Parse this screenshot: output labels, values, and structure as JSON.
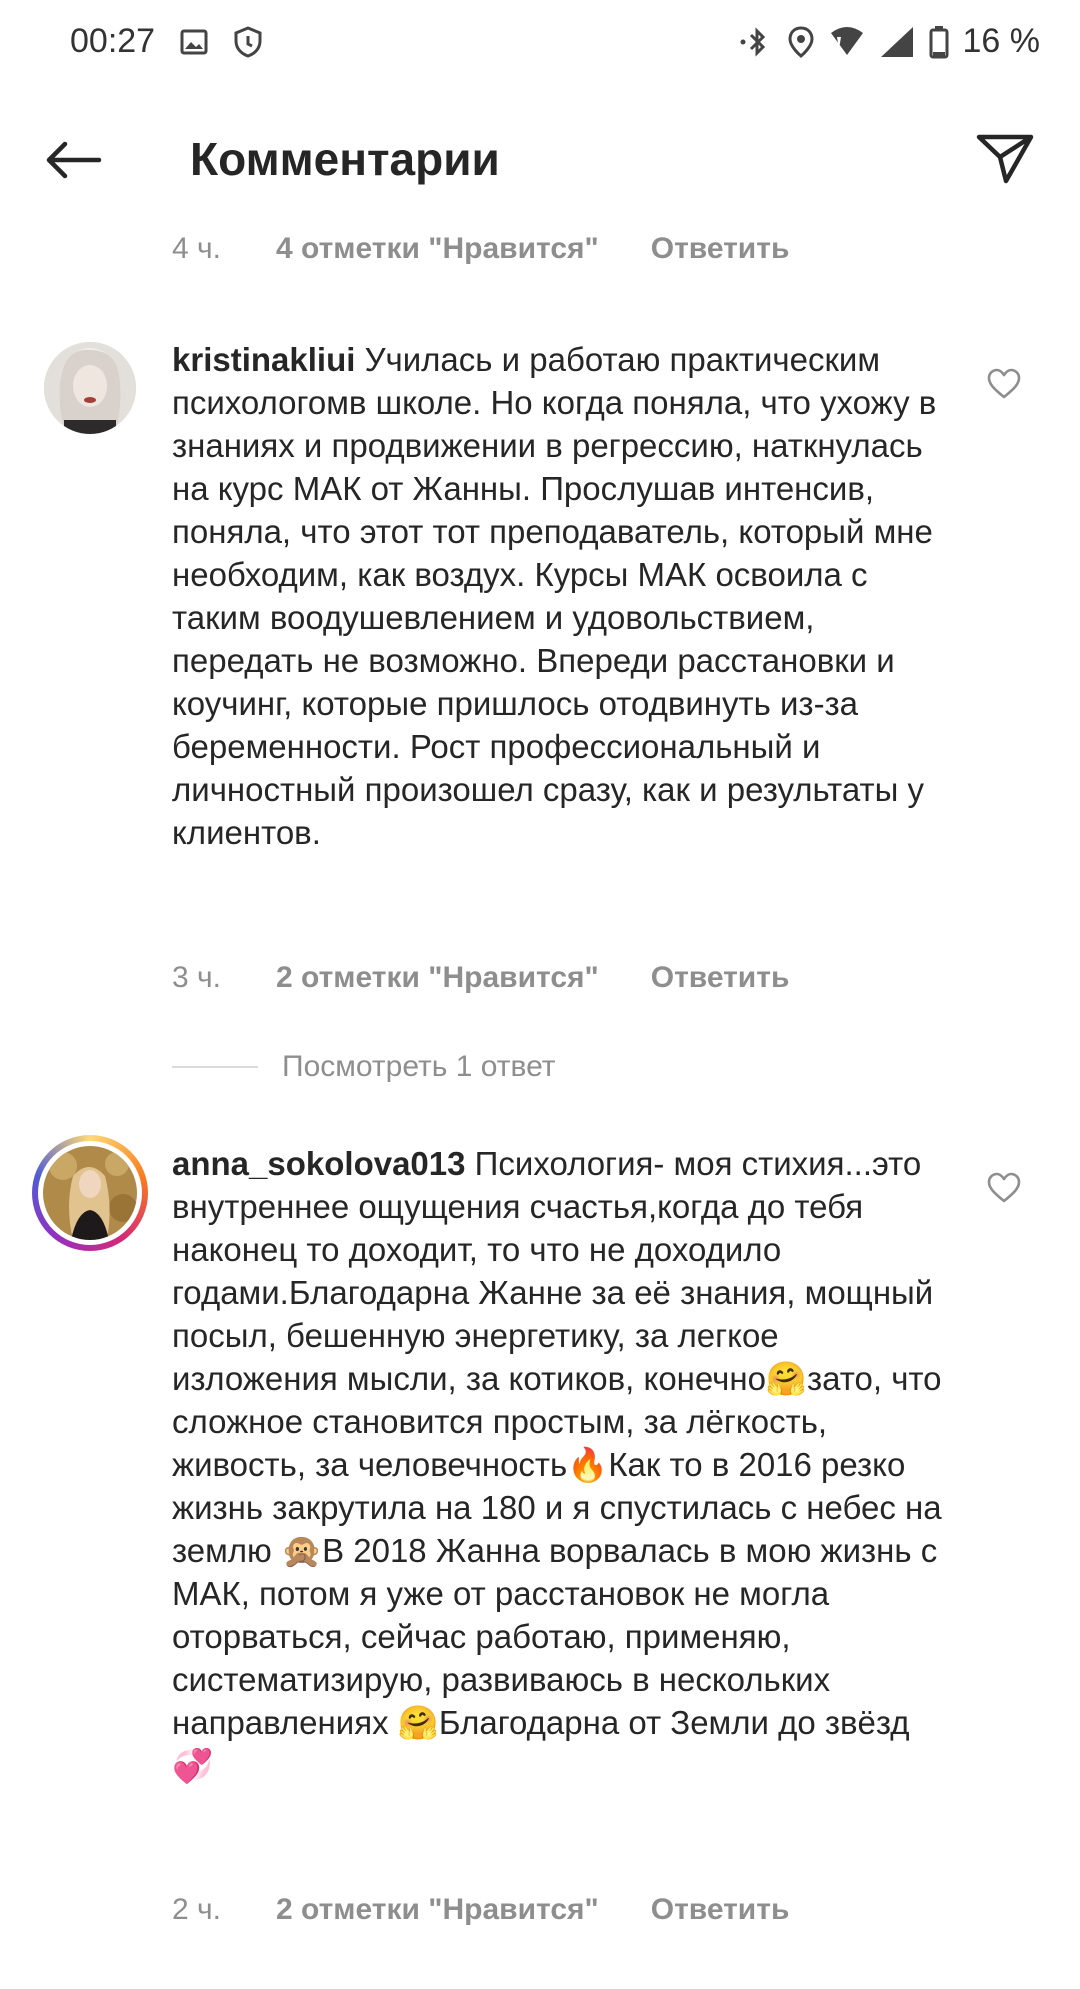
{
  "status_bar": {
    "time": "00:27",
    "battery": "16 %",
    "icons": [
      "image-icon",
      "shield-icon",
      "bluetooth-icon",
      "location-icon",
      "wifi-icon",
      "signal-icon",
      "battery-icon"
    ]
  },
  "header": {
    "title": "Комментарии",
    "back_icon": "back-arrow-icon",
    "send_icon": "paper-plane-icon"
  },
  "previous_comment_meta": {
    "time": "4 ч.",
    "likes": "4 отметки \"Нравится\"",
    "reply": "Ответить"
  },
  "comments": [
    {
      "username": "kristinakliui",
      "text": "Училась и работаю практическим психологомв школе. Но когда поняла, что ухожу в знаниях и продвижении в регрессию, наткнулась на курс МАК от Жанны. Прослушав интенсив, поняла, что этот тот преподаватель, который мне необходим, как воздух. Курсы МАК освоила с таким воодушевлением и удовольствием, передать не возможно. Впереди расстановки и коучинг, которые пришлось отодвинуть из-за беременности. Рост профессиональный и личностный произошел сразу, как и результаты у клиентов.",
      "time": "3 ч.",
      "likes": "2 отметки \"Нравится\"",
      "reply": "Ответить",
      "view_replies": "Посмотреть 1 ответ"
    },
    {
      "username": "anna_sokolova013",
      "text": "Психология- моя стихия...это внутреннее ощущения счастья,когда до тебя наконец то доходит, то что не доходило годами.Благодарна Жанне за её знания, мощный посыл, бешенную энергетику, за легкое изложения мысли, за котиков, конечно🤗зато, что сложное становится простым, за лёгкость, живость, за человечность🔥Как то в 2016 резко жизнь закрутила на 180 и я спустилась с небес на землю 🙊В 2018 Жанна ворвалась в мою жизнь с МАК, потом я уже от расстановок не могла оторваться, сейчас работаю, применяю, систематизирую, развиваюсь в нескольких направлениях 🤗Благодарна от Земли до звёзд 💞",
      "time": "2 ч.",
      "likes": "2 отметки \"Нравится\"",
      "reply": "Ответить"
    }
  ]
}
